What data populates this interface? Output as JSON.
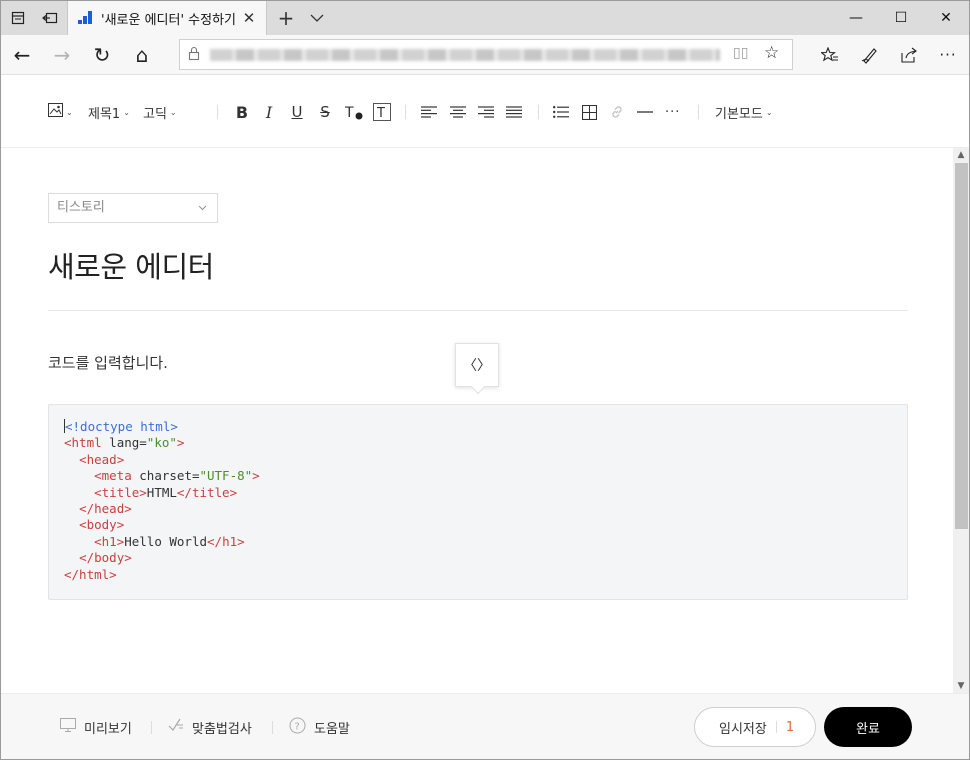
{
  "browser": {
    "tab_title": "'새로운 에디터' 수정하기",
    "tab_close": "✕",
    "new_tab": "+",
    "controls": {
      "minimize": "—",
      "maximize": "☐",
      "close": "✕"
    }
  },
  "nav": {
    "back": "←",
    "forward": "→",
    "refresh": "↻",
    "home": "⌂",
    "url_blurred": "",
    "more": "···"
  },
  "toolbar": {
    "heading": "제목1",
    "font": "고딕",
    "mode": "기본모드",
    "bold": "B",
    "italic": "I",
    "underline": "U",
    "strike": "S"
  },
  "editor": {
    "category": "티스토리",
    "title": "새로운 에디터",
    "paragraph": "코드를 입력합니다.",
    "code_button": "〈〉",
    "code": {
      "l1": "<!doctype html>",
      "l2_open": "<html",
      "l2_attr": " lang=",
      "l2_val": "\"ko\"",
      "l2_close": ">",
      "l3": "<head>",
      "l4_open": "<meta",
      "l4_attr": " charset=",
      "l4_val": "\"UTF-8\"",
      "l4_close": ">",
      "l5_open": "<title>",
      "l5_text": "HTML",
      "l5_close": "</title>",
      "l6": "</head>",
      "l7": "<body>",
      "l8_open": "<h1>",
      "l8_text": "Hello World",
      "l8_close": "</h1>",
      "l9": "</body>",
      "l10": "</html>"
    }
  },
  "footer": {
    "preview": "미리보기",
    "spellcheck": "맞춤법검사",
    "help": "도움말",
    "temp_save": "임시저장",
    "temp_count": "1",
    "done": "완료"
  },
  "colors": {
    "accent_count": "#f06a3a",
    "done_bg": "#000000",
    "code_tag": "#c94040",
    "code_doctype": "#3b6fd8",
    "code_string": "#4a8f2a"
  }
}
